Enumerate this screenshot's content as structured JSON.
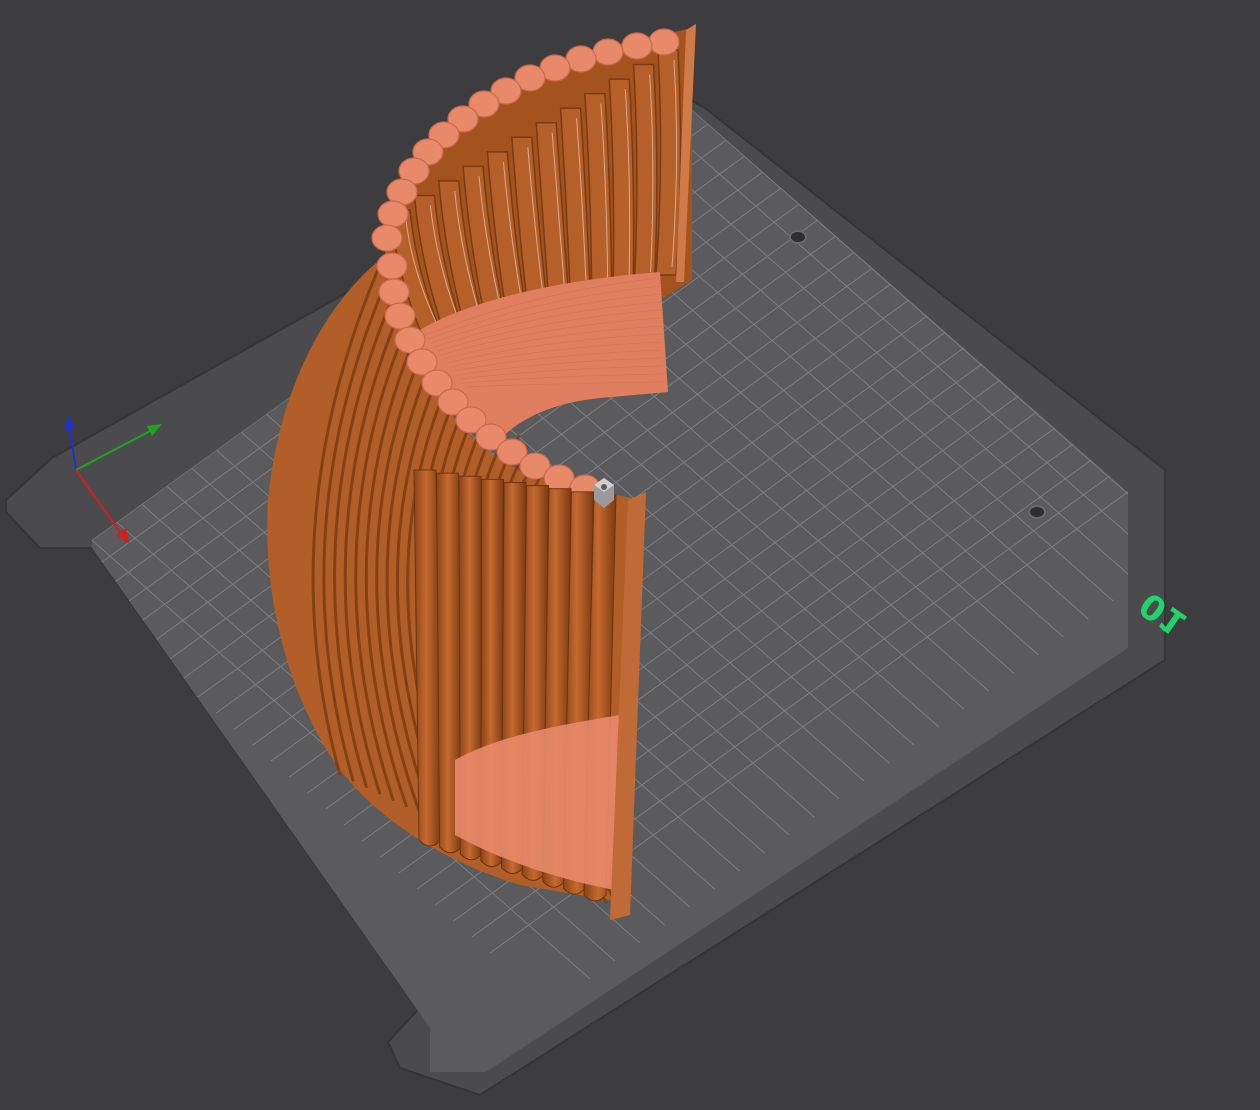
{
  "viewport": {
    "background_color": "#3d3d3f"
  },
  "build_plate": {
    "plate_number_label": "01",
    "plate_color": "#5b5b5e",
    "plate_edge_color": "#4a4a4d",
    "grid_line_color": "#8a8a8e",
    "label_color": "#1fd46b"
  },
  "model": {
    "body_color": "#b8622a",
    "rib_shadow_color": "#8a4418",
    "top_face_color": "#e58a6a",
    "fill_color": "#d97a5c"
  },
  "axes_gizmo": {
    "x_color": "#d01f1f",
    "y_color": "#1fa41f",
    "z_color": "#1f2fd0"
  },
  "icons": {
    "origin_marker": "origin-marker-icon",
    "plate_screw": "plate-screw-icon"
  }
}
